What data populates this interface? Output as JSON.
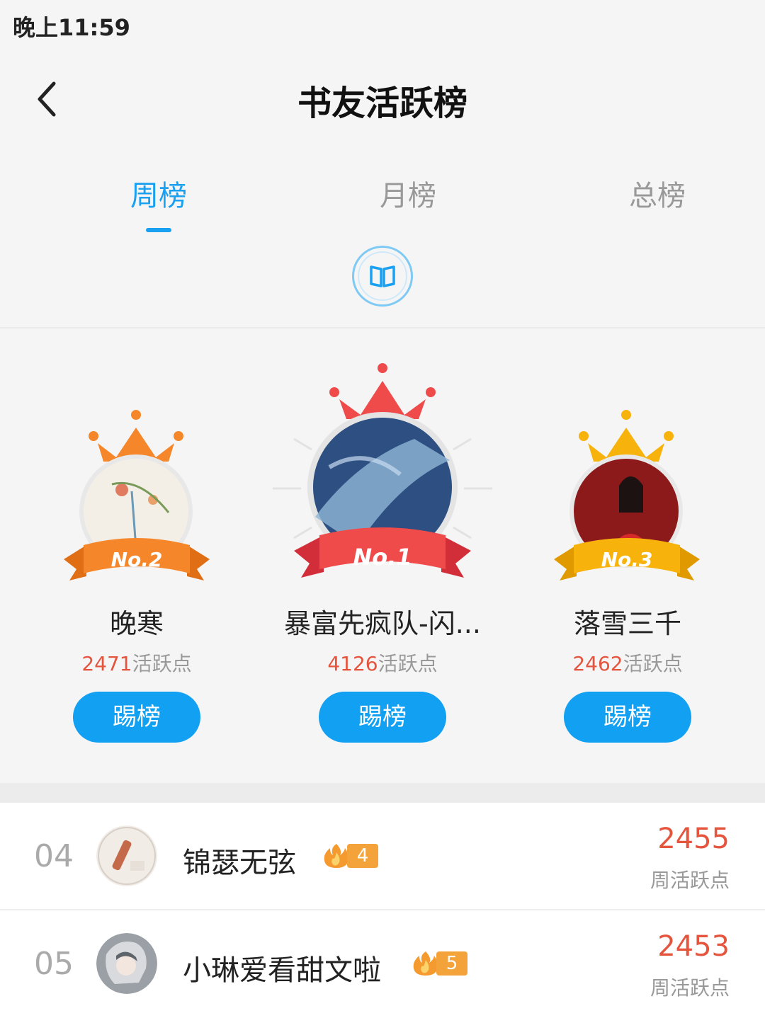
{
  "status_bar": {
    "time": "晚上11:59"
  },
  "header": {
    "title": "书友活跃榜"
  },
  "tabs": [
    {
      "label": "周榜",
      "active": true
    },
    {
      "label": "月榜",
      "active": false
    },
    {
      "label": "总榜",
      "active": false
    }
  ],
  "podium": [
    {
      "rank_badge": "No.2",
      "name": "晚寒",
      "points": "2471",
      "points_unit": "活跃点",
      "button": "踢榜",
      "crown_color": "#f5862a"
    },
    {
      "rank_badge": "No.1",
      "name": "暴富先疯队-闪...",
      "points": "4126",
      "points_unit": "活跃点",
      "button": "踢榜",
      "crown_color": "#ef4b4b"
    },
    {
      "rank_badge": "No.3",
      "name": "落雪三千",
      "points": "2462",
      "points_unit": "活跃点",
      "button": "踢榜",
      "crown_color": "#f7b20c"
    }
  ],
  "list": [
    {
      "rank": "04",
      "name": "锦瑟无弦",
      "fire_level": "4",
      "points": "2455",
      "points_label": "周活跃点"
    },
    {
      "rank": "05",
      "name": "小琳爱看甜文啦",
      "fire_level": "5",
      "points": "2453",
      "points_label": "周活跃点"
    }
  ],
  "colors": {
    "accent": "#1aa0f0",
    "points": "#e5553e",
    "button": "#12a0f2"
  },
  "icons": {
    "back": "chevron-left-icon",
    "book": "book-icon",
    "fire": "fire-icon",
    "crown": "crown-icon"
  }
}
